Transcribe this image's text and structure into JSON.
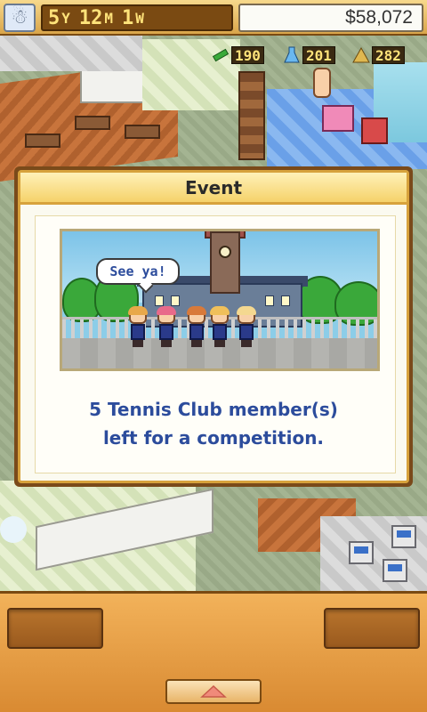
{
  "status": {
    "season_icon": "snowman-icon",
    "year": "5",
    "year_unit": "Y",
    "month": "12",
    "month_unit": "M",
    "week": "1",
    "week_unit": "W",
    "money": "$58,072"
  },
  "resources": [
    {
      "icon": "pencil-icon",
      "value": "190",
      "color": "#2a8a2a"
    },
    {
      "icon": "flask-icon",
      "value": "201",
      "color": "#3a8ad8"
    },
    {
      "icon": "pyramid-icon",
      "value": "282",
      "color": "#c8a040"
    }
  ],
  "event_dialog": {
    "title": "Event",
    "speech_bubble": "See ya!",
    "message_line1": "5 Tennis Club member(s)",
    "message_line2": "left for a competition."
  },
  "colors": {
    "accent_gold": "#d7a23c",
    "message_blue": "#2c4c9c",
    "panel_orange": "#e89a42"
  }
}
